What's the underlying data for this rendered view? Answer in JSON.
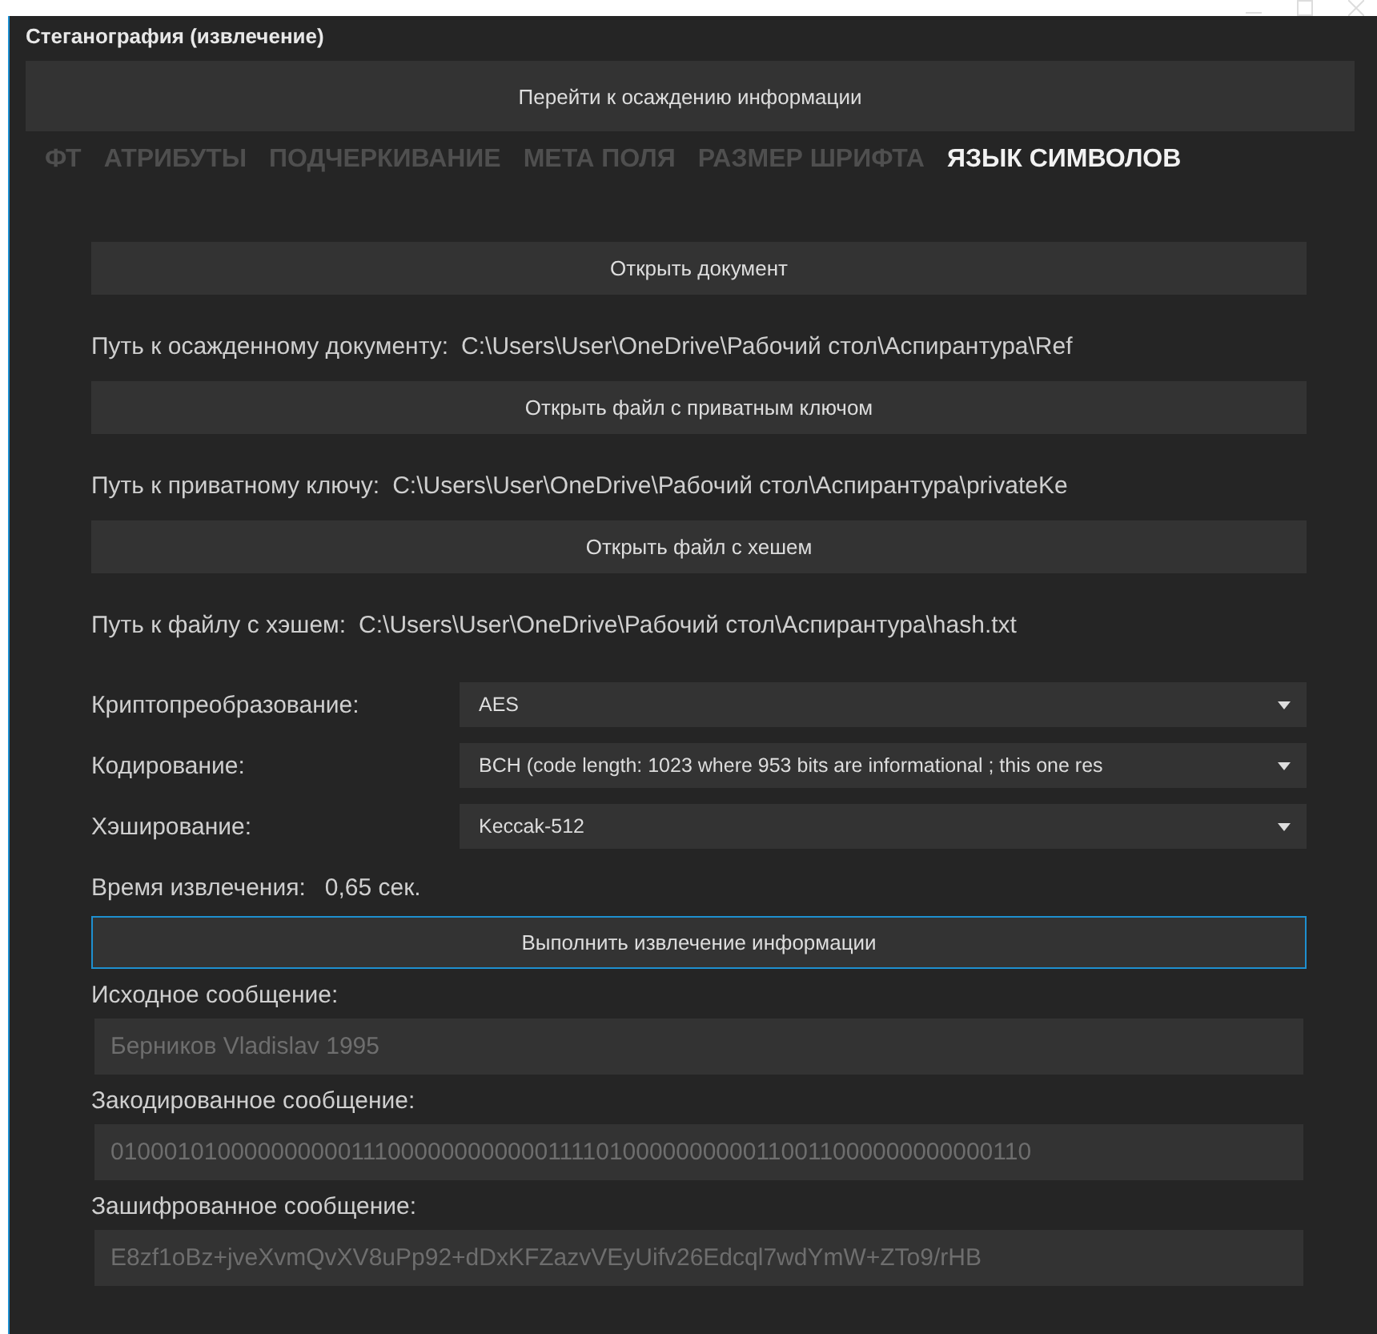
{
  "window": {
    "title": "Стеганография (извлечение)"
  },
  "nav_button": "Перейти к осаждению информации",
  "tabs": [
    {
      "label": "ФТ",
      "selected": false
    },
    {
      "label": "АТРИБУТЫ",
      "selected": false
    },
    {
      "label": "ПОДЧЕРКИВАНИЕ",
      "selected": false
    },
    {
      "label": "МЕТА ПОЛЯ",
      "selected": false
    },
    {
      "label": "РАЗМЕР ШРИФТА",
      "selected": false
    },
    {
      "label": "ЯЗЫК СИМВОЛОВ",
      "selected": true
    }
  ],
  "file_rows": [
    {
      "button": "Открыть документ",
      "path_label": "Путь к осажденному документу:",
      "path": "C:\\Users\\User\\OneDrive\\Рабочий стол\\Аспирантура\\Ref"
    },
    {
      "button": "Открыть файл с приватным ключом",
      "path_label": "Путь к приватному ключу:",
      "path": "C:\\Users\\User\\OneDrive\\Рабочий стол\\Аспирантура\\privateKe"
    },
    {
      "button": "Открыть файл с хешем",
      "path_label": "Путь к файлу с хэшем:",
      "path": "C:\\Users\\User\\OneDrive\\Рабочий стол\\Аспирантура\\hash.txt"
    }
  ],
  "options": [
    {
      "label": "Криптопреобразование:",
      "value": "AES"
    },
    {
      "label": "Кодирование:",
      "value": "BCH (code length: 1023 where 953 bits are informational ; this one res"
    },
    {
      "label": "Хэширование:",
      "value": "Keccak-512"
    }
  ],
  "time": {
    "label": "Время извлечения:",
    "value": "0,65 сек."
  },
  "run_button": {
    "label": "Выполнить извлечение информации",
    "focused": true
  },
  "messages": [
    {
      "label": "Исходное сообщение:",
      "value": "Берников Vladislav 1995"
    },
    {
      "label": "Закодированное сообщение:",
      "value": "0100010100000000001110000000000001111010000000000110011000000000000110"
    },
    {
      "label": "Зашифрованное сообщение:",
      "value": "E8zf1oBz+jveXvmQvXV8uPp92+dDxKFZazvVEyUifv26Edcql7wdYmW+ZTo9/rHB"
    }
  ]
}
